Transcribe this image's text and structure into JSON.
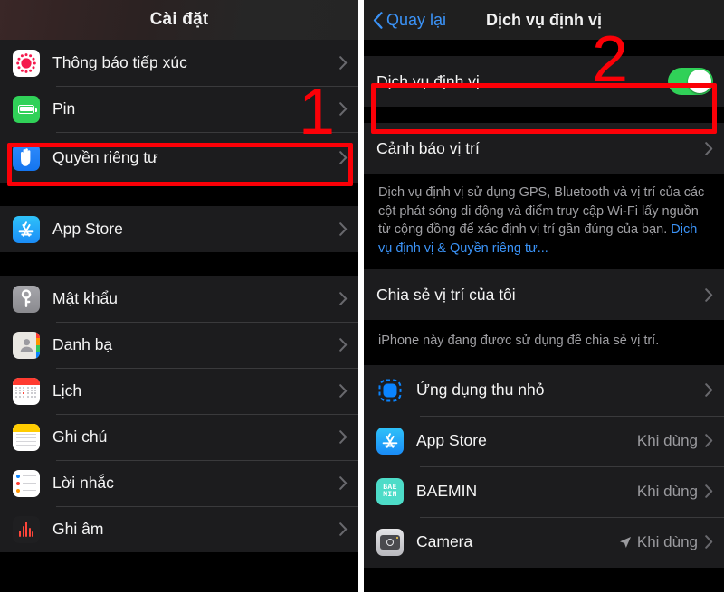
{
  "left_panel": {
    "nav_title": "Cài đặt",
    "groups": [
      {
        "rows": [
          {
            "label": "Thông báo tiếp xúc",
            "icon": "exposure-notification-icon"
          },
          {
            "label": "Pin",
            "icon": "battery-icon"
          },
          {
            "label": "Quyền riêng tư",
            "icon": "privacy-hand-icon",
            "highlighted": true
          }
        ]
      },
      {
        "rows": [
          {
            "label": "App Store",
            "icon": "app-store-icon"
          }
        ]
      },
      {
        "rows": [
          {
            "label": "Mật khẩu",
            "icon": "passwords-key-icon"
          },
          {
            "label": "Danh bạ",
            "icon": "contacts-icon"
          },
          {
            "label": "Lịch",
            "icon": "calendar-icon"
          },
          {
            "label": "Ghi chú",
            "icon": "notes-icon"
          },
          {
            "label": "Lời nhắc",
            "icon": "reminders-icon"
          },
          {
            "label": "Ghi âm",
            "icon": "voice-memos-icon"
          }
        ]
      }
    ]
  },
  "right_panel": {
    "back_label": "Quay lại",
    "nav_title": "Dịch vụ định vị",
    "location_services": {
      "label": "Dịch vụ định vị",
      "toggle_state": "on",
      "toggle_color": "#30d158"
    },
    "location_alerts": {
      "label": "Cảnh báo vị trí"
    },
    "description": {
      "text": "Dịch vụ định vị sử dụng GPS, Bluetooth và vị trí của các cột phát sóng di động và điểm truy cập Wi-Fi lấy nguồn từ cộng đồng để xác định vị trí gần đúng của bạn. ",
      "link": "Dịch vụ định vị & Quyền riêng tư...",
      "link_color": "#3b93f7"
    },
    "share_location": {
      "label": "Chia sẻ vị trí của tôi",
      "footnote": "iPhone này đang được sử dụng để chia sẻ vị trí."
    },
    "apps": [
      {
        "label": "Ứng dụng thu nhỏ",
        "value": "",
        "icon": "app-clips-icon",
        "arrow": false
      },
      {
        "label": "App Store",
        "value": "Khi dùng",
        "icon": "app-store-icon",
        "arrow": false
      },
      {
        "label": "BAEMIN",
        "value": "Khi dùng",
        "icon": "baemin-icon",
        "arrow": false
      },
      {
        "label": "Camera",
        "value": "Khi dùng",
        "icon": "camera-icon",
        "arrow": true
      }
    ]
  },
  "annotations": {
    "color": "#fb0007",
    "step_one": "1",
    "step_two": "2"
  }
}
